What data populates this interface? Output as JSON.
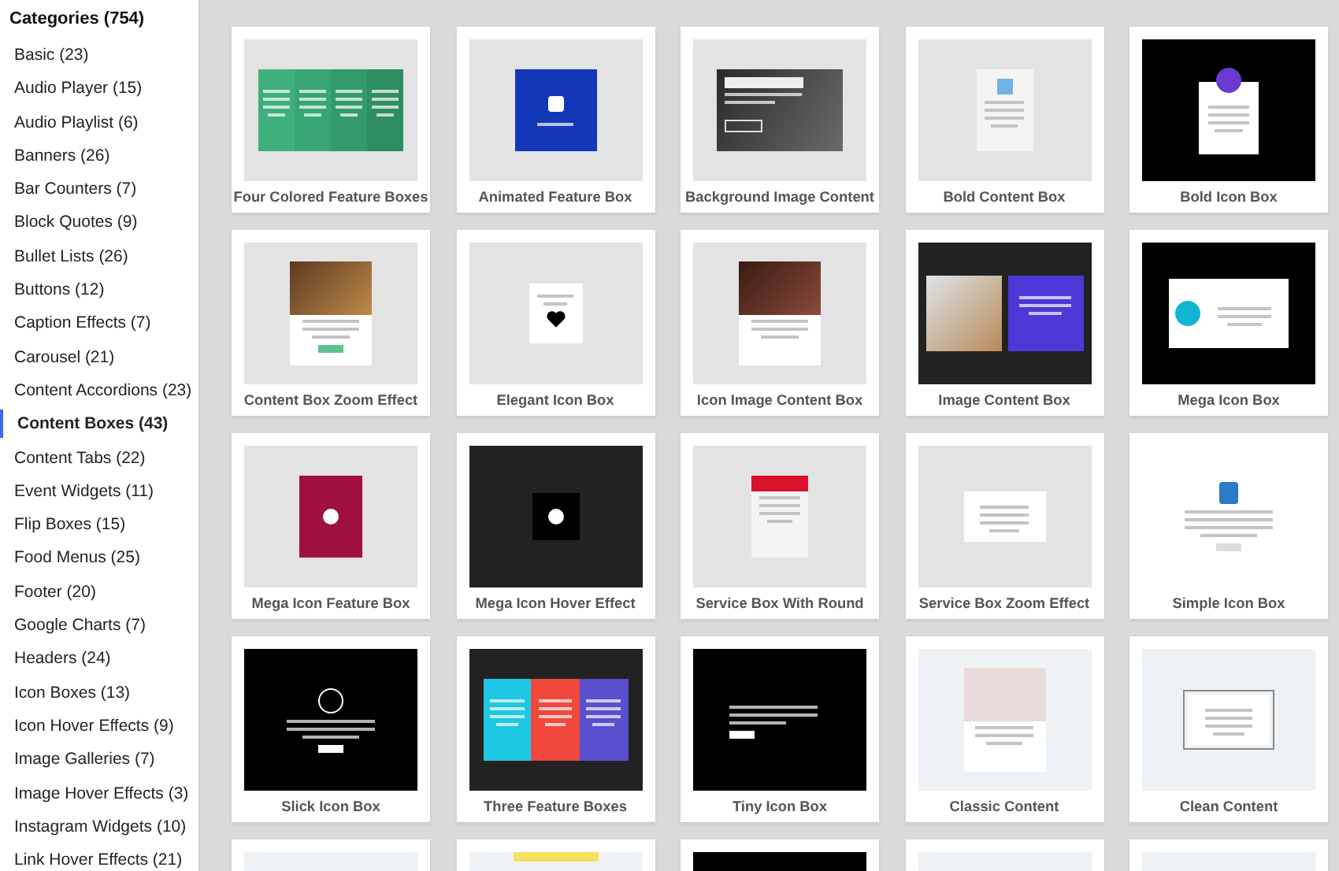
{
  "sidebar": {
    "title": "Categories (754)",
    "items": [
      {
        "label": "Basic (23)",
        "selected": false
      },
      {
        "label": "Audio Player (15)",
        "selected": false
      },
      {
        "label": "Audio Playlist (6)",
        "selected": false
      },
      {
        "label": "Banners (26)",
        "selected": false
      },
      {
        "label": "Bar Counters (7)",
        "selected": false
      },
      {
        "label": "Block Quotes (9)",
        "selected": false
      },
      {
        "label": "Bullet Lists (26)",
        "selected": false
      },
      {
        "label": "Buttons (12)",
        "selected": false
      },
      {
        "label": "Caption Effects (7)",
        "selected": false
      },
      {
        "label": "Carousel (21)",
        "selected": false
      },
      {
        "label": "Content Accordions (23)",
        "selected": false
      },
      {
        "label": "Content Boxes (43)",
        "selected": true
      },
      {
        "label": "Content Tabs (22)",
        "selected": false
      },
      {
        "label": "Event Widgets (11)",
        "selected": false
      },
      {
        "label": "Flip Boxes (15)",
        "selected": false
      },
      {
        "label": "Food Menus (25)",
        "selected": false
      },
      {
        "label": "Footer (20)",
        "selected": false
      },
      {
        "label": "Google Charts (7)",
        "selected": false
      },
      {
        "label": "Headers (24)",
        "selected": false
      },
      {
        "label": "Icon Boxes (13)",
        "selected": false
      },
      {
        "label": "Icon Hover Effects (9)",
        "selected": false
      },
      {
        "label": "Image Galleries (7)",
        "selected": false
      },
      {
        "label": "Image Hover Effects (3)",
        "selected": false
      },
      {
        "label": "Instagram Widgets (10)",
        "selected": false
      },
      {
        "label": "Link Hover Effects (21)",
        "selected": false
      }
    ]
  },
  "templates": [
    {
      "label": "Four Colored Feature Boxes",
      "kind": "columns"
    },
    {
      "label": "Animated Feature Box",
      "kind": "tile"
    },
    {
      "label": "Background Image Content",
      "kind": "banner"
    },
    {
      "label": "Bold Content Box",
      "kind": "card"
    },
    {
      "label": "Bold Icon Box",
      "kind": "badge"
    },
    {
      "label": "Content Box Zoom Effect",
      "kind": "photo"
    },
    {
      "label": "Elegant Icon Box",
      "kind": "heart"
    },
    {
      "label": "Icon Image Content Box",
      "kind": "recipe"
    },
    {
      "label": "Image Content Box",
      "kind": "split"
    },
    {
      "label": "Mega Icon Box",
      "kind": "feature"
    },
    {
      "label": "Mega Icon Feature Box",
      "kind": "gear"
    },
    {
      "label": "Mega Icon Hover Effect",
      "kind": "leaf"
    },
    {
      "label": "Service Box With Round",
      "kind": "ribbon"
    },
    {
      "label": "Service Box Zoom Effect",
      "kind": "note"
    },
    {
      "label": "Simple Icon Box",
      "kind": "wrench"
    },
    {
      "label": "Slick Icon Box",
      "kind": "ring"
    },
    {
      "label": "Three Feature Boxes",
      "kind": "trio"
    },
    {
      "label": "Tiny Icon Box",
      "kind": "strip"
    },
    {
      "label": "Classic Content",
      "kind": "classic"
    },
    {
      "label": "Clean Content",
      "kind": "clean"
    },
    {
      "kind": "blank"
    },
    {
      "kind": "sunny"
    },
    {
      "kind": "dark"
    },
    {
      "kind": "blank"
    },
    {
      "kind": "blank"
    }
  ]
}
